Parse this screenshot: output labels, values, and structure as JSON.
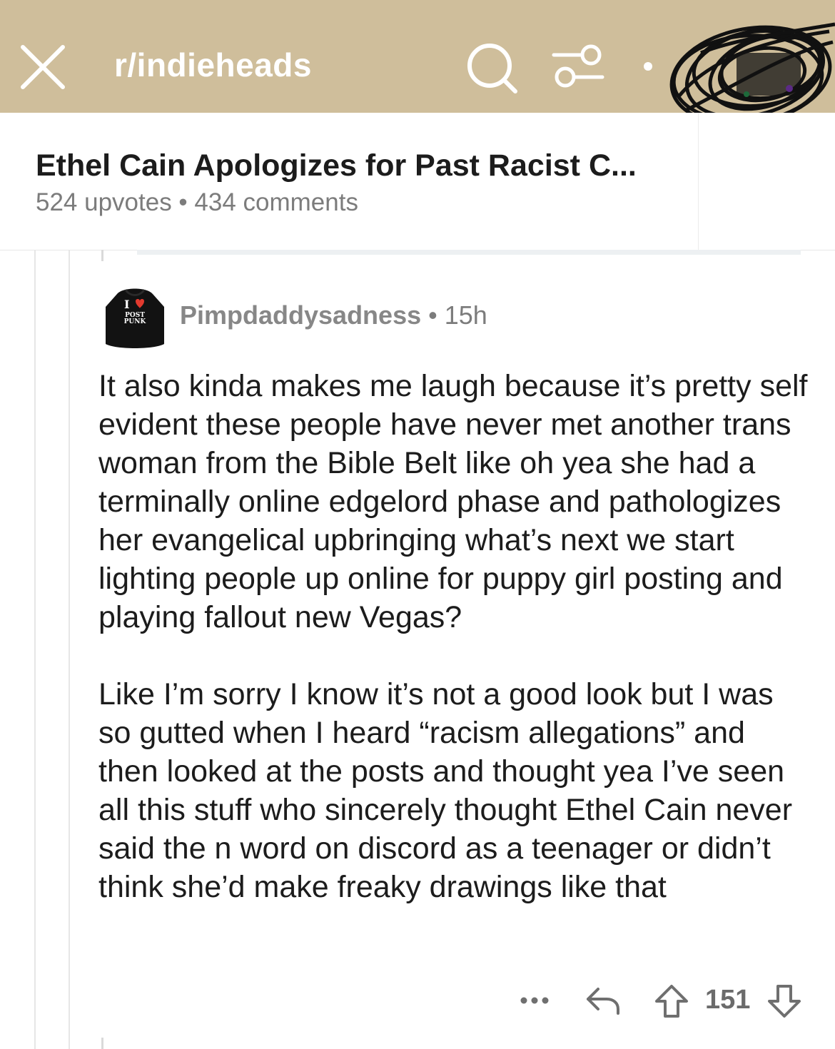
{
  "header": {
    "subreddit": "r/indieheads",
    "icons": [
      "close-icon",
      "search-icon",
      "filter-icon",
      "more-icon"
    ]
  },
  "post": {
    "title": "Ethel Cain Apologizes for Past Racist C...",
    "meta": "524 upvotes • 434 comments"
  },
  "comment": {
    "avatar_text_1": "I",
    "avatar_text_2": "POST",
    "avatar_text_3": "PUNK",
    "author": "Pimpdaddysadness",
    "separator": " • ",
    "time": "15h",
    "paragraphs": [
      "It also kinda makes me laugh because it’s pretty self evident these people have never met another trans woman from the Bible Belt like oh yea she had a terminally online edgelord phase and pathologizes her evangelical upbringing what’s next we start lighting people up online for puppy girl posting and playing fallout new Vegas?",
      "Like I’m sorry I know it’s not a good look but I was so gutted when I heard “racism allegations” and then looked at the posts and thought yea I’ve seen all this stuff who sincerely thought Ethel Cain never said the n word on discord as a teenager or didn’t think she’d make freaky drawings like that"
    ],
    "vote_count": "151"
  },
  "colors": {
    "header_bg": "#cfbe9b",
    "text": "#1c1c1c",
    "meta": "#7c7c7c"
  }
}
